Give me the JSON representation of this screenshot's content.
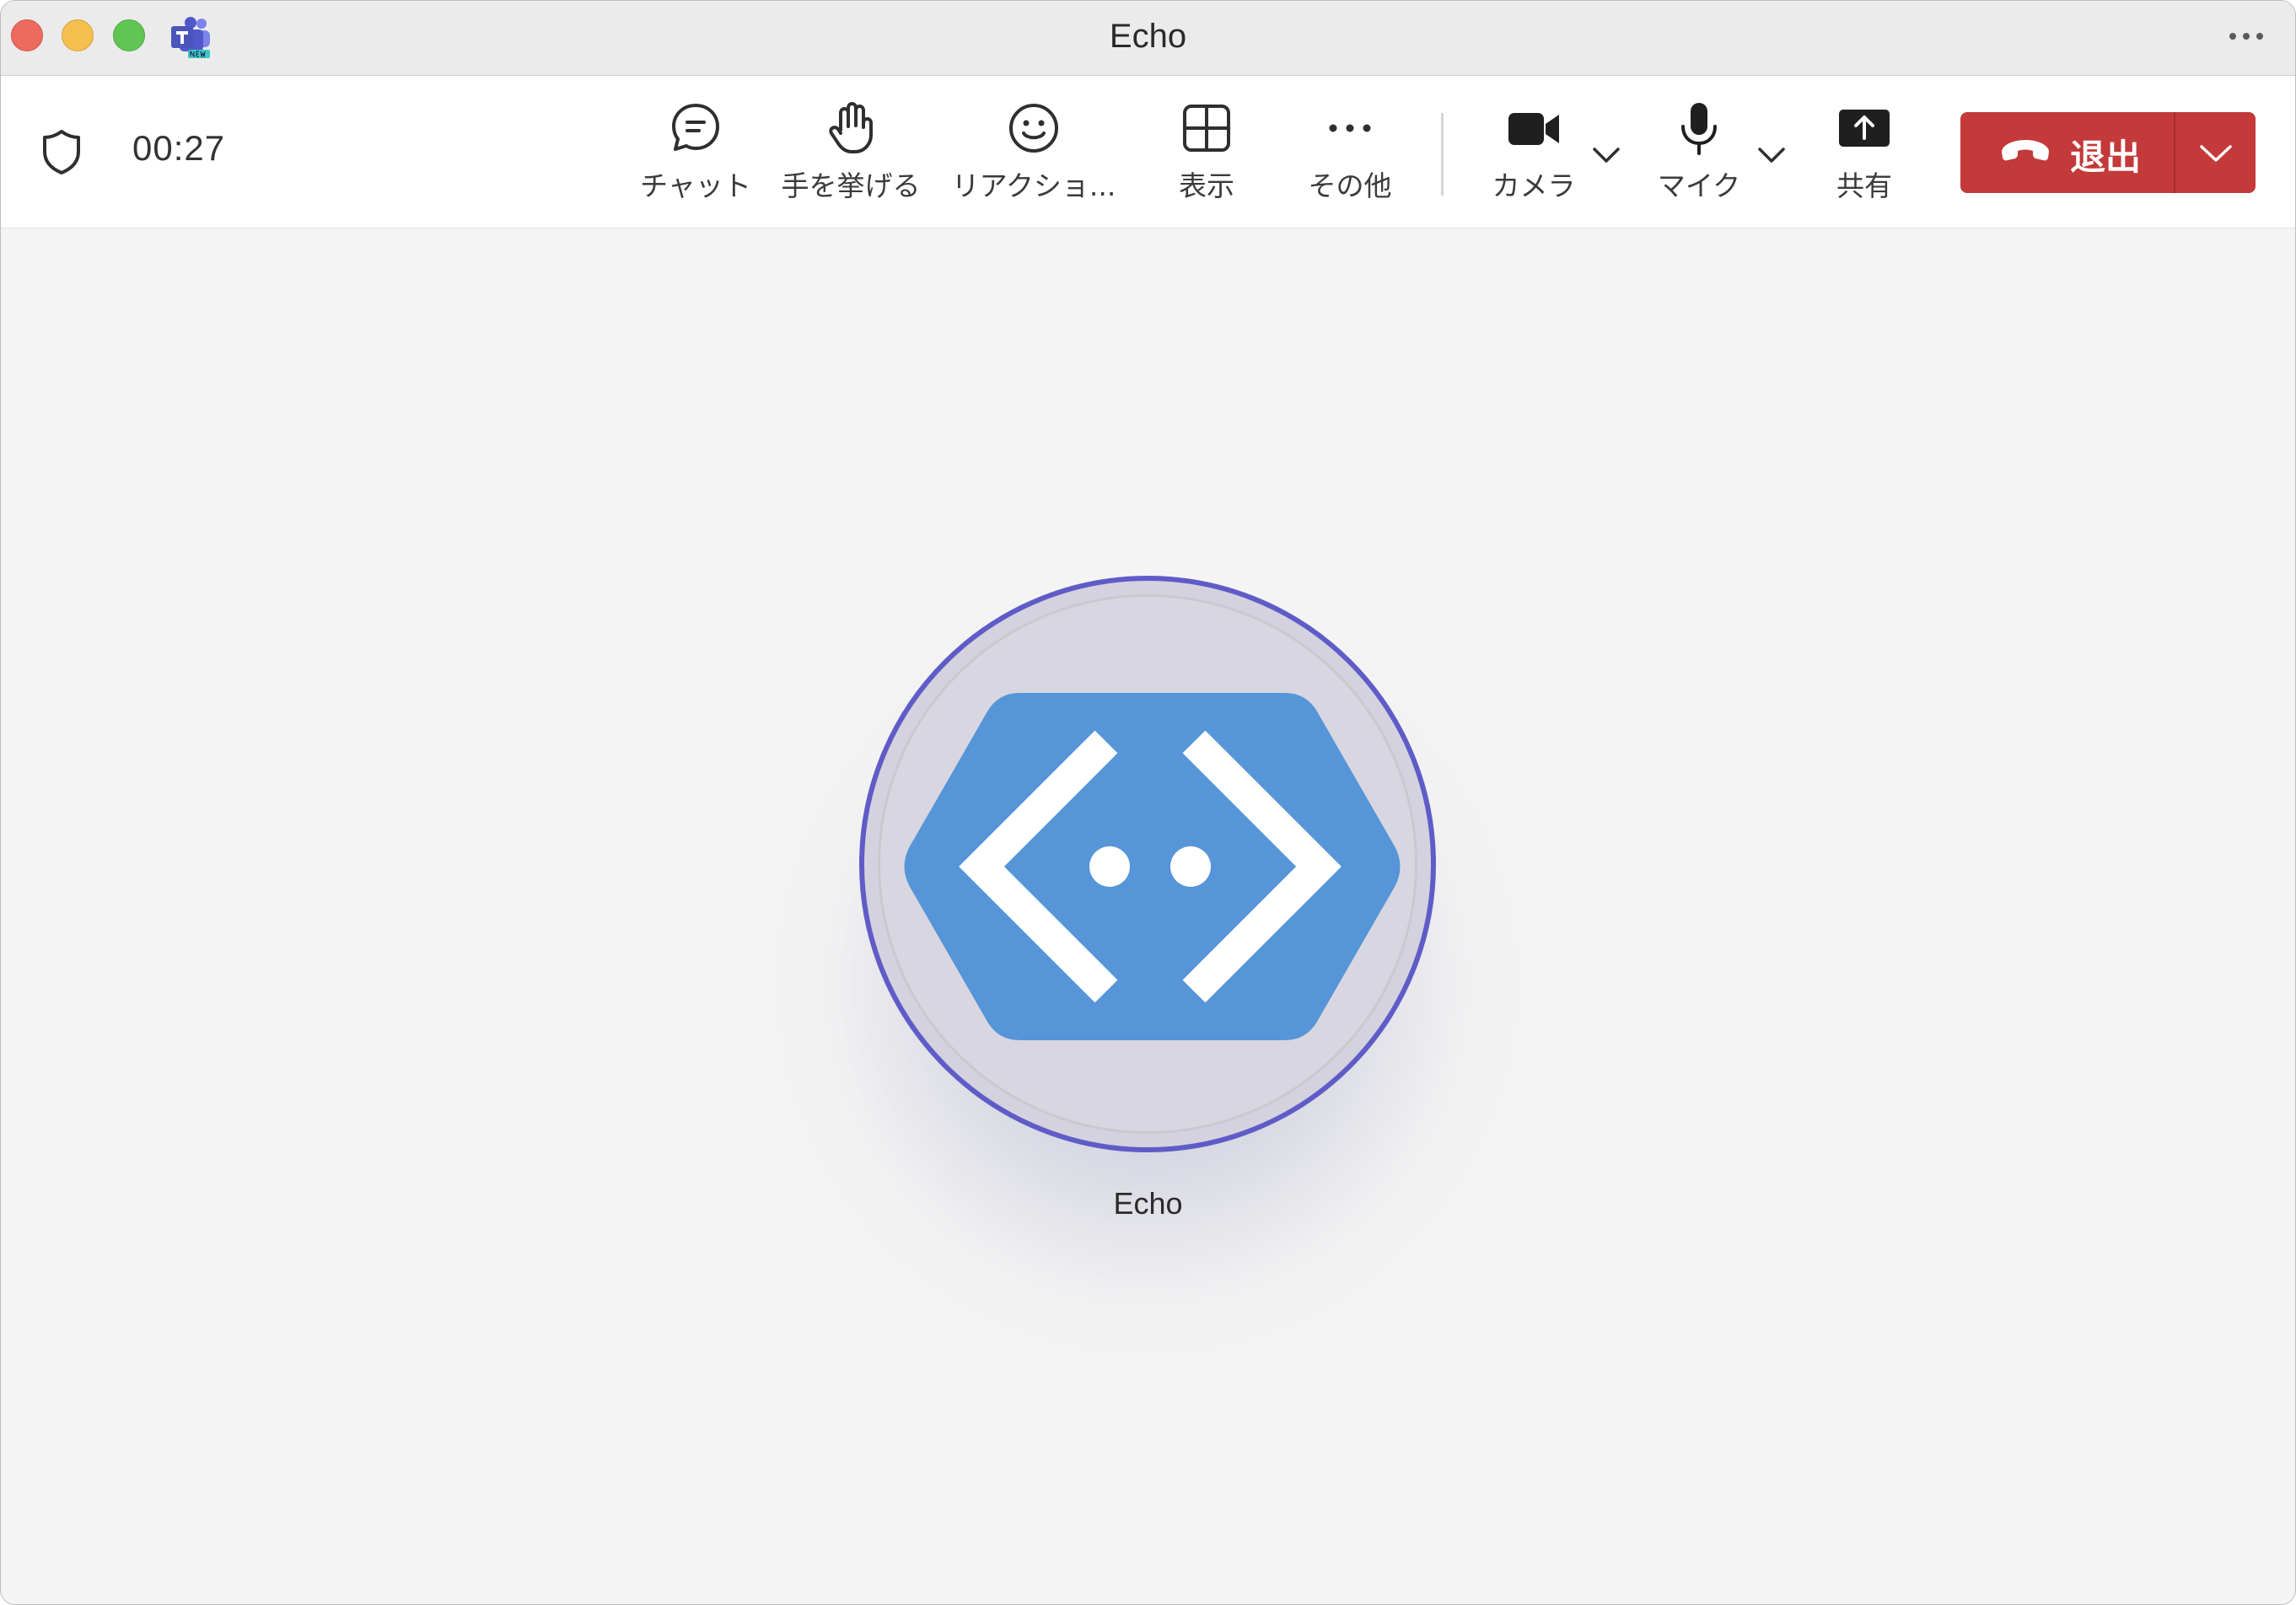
{
  "window": {
    "title": "Echo"
  },
  "toolbar": {
    "timer": "00:27",
    "chat_label": "チャット",
    "raise_hand_label": "手を挙げる",
    "reactions_label": "リアクショ...",
    "view_label": "表示",
    "more_label": "その他",
    "camera_label": "カメラ",
    "mic_label": "マイク",
    "share_label": "共有",
    "leave_label": "退出"
  },
  "stage": {
    "participant_name": "Echo"
  },
  "colors": {
    "leave_button": "#c4393a",
    "avatar_ring": "#5f5cc8",
    "avatar_hexagon": "#5595d8",
    "traffic_close": "#ed6a5e",
    "traffic_minimize": "#f5bf4f",
    "traffic_maximize": "#61c554"
  },
  "icons": {
    "title_bar": [
      "close-button",
      "minimize-button",
      "maximize-button",
      "teams-new-logo",
      "more-options-icon"
    ],
    "toolbar": [
      "shield-icon",
      "chat-icon",
      "hand-icon",
      "smiley-icon",
      "grid-icon",
      "ellipsis-icon",
      "video-camera-icon",
      "microphone-icon",
      "share-screen-icon",
      "hang-up-icon",
      "chevron-down-icon"
    ],
    "avatar": "bot-hexagon-icon"
  }
}
